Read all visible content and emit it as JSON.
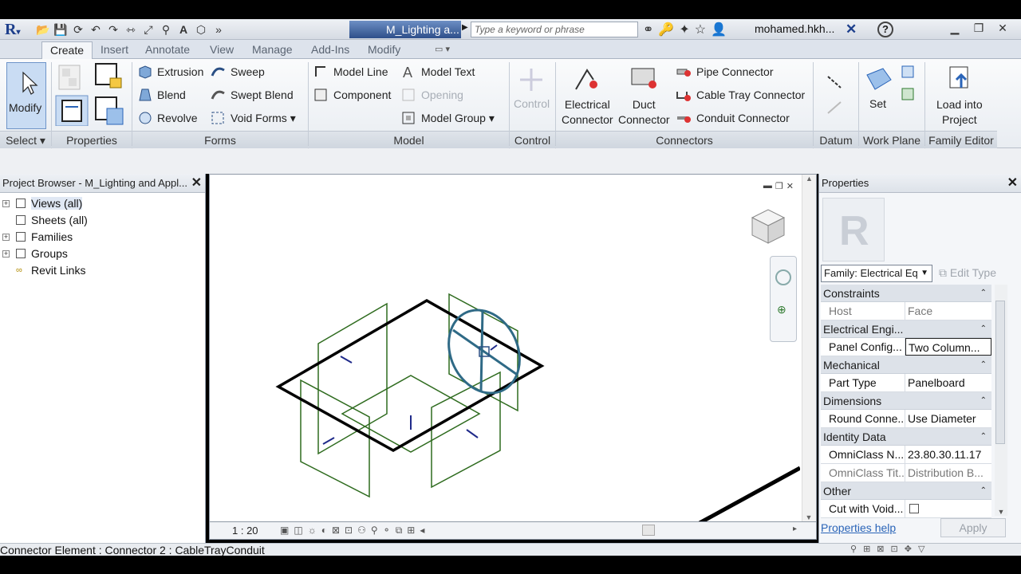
{
  "app": {
    "logo": "R",
    "doc_title": "M_Lighting a...",
    "search_placeholder": "Type a keyword or phrase",
    "user": "mohamed.hkh..."
  },
  "tabs": [
    "Create",
    "Insert",
    "Annotate",
    "View",
    "Manage",
    "Add-Ins",
    "Modify"
  ],
  "ribbon": {
    "select": {
      "modify": "Modify",
      "title": "Select"
    },
    "properties": {
      "title": "Properties"
    },
    "forms": {
      "extrusion": "Extrusion",
      "blend": "Blend",
      "revolve": "Revolve",
      "sweep": "Sweep",
      "swept_blend": "Swept Blend",
      "void_forms": "Void Forms",
      "title": "Forms"
    },
    "model": {
      "model_line": "Model Line",
      "component": "Component",
      "model_text": "Model Text",
      "opening": "Opening",
      "model_group": "Model Group",
      "title": "Model"
    },
    "control": {
      "control": "Control",
      "title": "Control"
    },
    "connectors": {
      "electrical_1": "Electrical",
      "electrical_2": "Connector",
      "duct_1": "Duct",
      "duct_2": "Connector",
      "pipe": "Pipe Connector",
      "cable_tray": "Cable Tray Connector",
      "conduit": "Conduit Connector",
      "title": "Connectors"
    },
    "datum": {
      "title": "Datum"
    },
    "work_plane": {
      "set": "Set",
      "title": "Work Plane"
    },
    "family_editor": {
      "load_1": "Load into",
      "load_2": "Project",
      "title": "Family Editor"
    }
  },
  "project_browser": {
    "title": "Project Browser - M_Lighting and Appl...",
    "items": [
      {
        "label": "Views (all)",
        "expand": "+"
      },
      {
        "label": "Sheets (all)",
        "expand": ""
      },
      {
        "label": "Families",
        "expand": "+"
      },
      {
        "label": "Groups",
        "expand": "+"
      },
      {
        "label": "Revit Links",
        "expand": ""
      }
    ]
  },
  "viewport": {
    "scale": "1 : 20"
  },
  "properties": {
    "title": "Properties",
    "family": "Family: Electrical Eq",
    "edit_type": "Edit Type",
    "sections": [
      {
        "name": "Constraints",
        "rows": [
          {
            "k": "Host",
            "v": "Face",
            "ro": true
          }
        ]
      },
      {
        "name": "Electrical Engi...",
        "rows": [
          {
            "k": "Panel Config...",
            "v": "Two Column...",
            "boxed": true
          }
        ]
      },
      {
        "name": "Mechanical",
        "rows": [
          {
            "k": "Part Type",
            "v": "Panelboard"
          }
        ]
      },
      {
        "name": "Dimensions",
        "rows": [
          {
            "k": "Round Conne...",
            "v": "Use Diameter"
          }
        ]
      },
      {
        "name": "Identity Data",
        "rows": [
          {
            "k": "OmniClass N...",
            "v": "23.80.30.11.17"
          },
          {
            "k": "OmniClass Tit...",
            "v": "Distribution B...",
            "ro": true
          }
        ]
      },
      {
        "name": "Other",
        "rows": [
          {
            "k": "Cut with Void...",
            "v": ""
          }
        ]
      }
    ],
    "help": "Properties help",
    "apply": "Apply"
  },
  "status": {
    "text": "Connector Element : Connector 2 : CableTrayConduit"
  },
  "colors": {
    "accent": "#1d3f8c",
    "frame_line": "#000000",
    "connector_plane": "#2e6b1e",
    "connector_circle": "#2f6a86"
  }
}
